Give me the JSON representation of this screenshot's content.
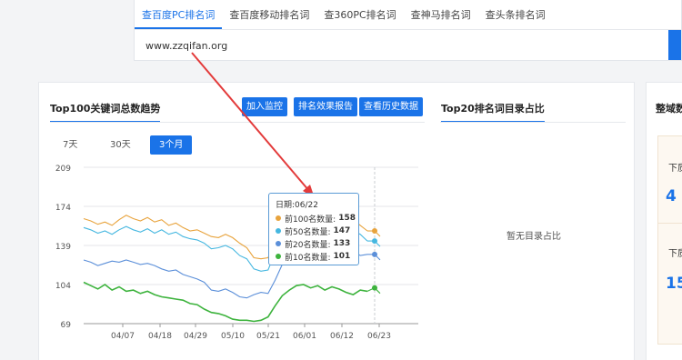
{
  "tabs": [
    {
      "label": "查百度PC排名词",
      "active": true
    },
    {
      "label": "查百度移动排名词",
      "active": false
    },
    {
      "label": "查360PC排名词",
      "active": false
    },
    {
      "label": "查神马排名词",
      "active": false
    },
    {
      "label": "查头条排名词",
      "active": false
    }
  ],
  "search": {
    "value": "www.zzqifan.org"
  },
  "panel": {
    "title": "Top100关键词总数趋势",
    "buttons": {
      "monitor": "加入监控",
      "report": "排名效果报告",
      "history": "查看历史数据"
    },
    "ranges": [
      {
        "label": "7天",
        "active": false
      },
      {
        "label": "30天",
        "active": false
      },
      {
        "label": "3个月",
        "active": true
      }
    ]
  },
  "right_panel": {
    "title": "Top20排名词目录占比",
    "empty_text": "暂无目录占比"
  },
  "side_card": {
    "title": "整域数",
    "label_1": "下质",
    "value_1": "4",
    "label_2": "下质",
    "value_2": "15"
  },
  "tooltip": {
    "date_label": "日期:06/22",
    "rows": [
      {
        "label": "前100名数量:",
        "value": "158",
        "color": "#e8a33c"
      },
      {
        "label": "前50名数量:",
        "value": "147",
        "color": "#45b7e0"
      },
      {
        "label": "前20名数量:",
        "value": "133",
        "color": "#5b8fd9"
      },
      {
        "label": "前10名数量:",
        "value": "101",
        "color": "#3db33d"
      }
    ]
  },
  "chart_data": {
    "type": "line",
    "y_ticks": [
      69,
      104,
      139,
      174,
      209
    ],
    "x_tick_labels": [
      "04/07",
      "04/18",
      "04/29",
      "05/10",
      "05/21",
      "06/01",
      "06/12",
      "06/23"
    ],
    "ylim": [
      69,
      209
    ],
    "grid": true,
    "series": [
      {
        "name": "前100名数量",
        "color": "#e8a33c",
        "end_value": 152,
        "values": [
          163,
          161,
          158,
          160,
          157,
          162,
          166,
          163,
          161,
          164,
          160,
          162,
          157,
          159,
          155,
          152,
          153,
          150,
          147,
          146,
          149,
          146,
          141,
          137,
          128,
          127,
          128,
          142,
          152,
          163,
          166,
          164,
          162,
          165,
          163,
          168,
          167,
          165,
          162,
          157,
          152
        ]
      },
      {
        "name": "前50名数量",
        "color": "#45b7e0",
        "end_value": 143,
        "values": [
          155,
          153,
          150,
          152,
          149,
          153,
          156,
          153,
          151,
          154,
          150,
          153,
          149,
          151,
          147,
          145,
          144,
          141,
          136,
          137,
          139,
          136,
          130,
          127,
          118,
          116,
          117,
          133,
          144,
          154,
          156,
          155,
          153,
          156,
          154,
          158,
          157,
          155,
          152,
          149,
          143
        ]
      },
      {
        "name": "前20名数量",
        "color": "#5b8fd9",
        "end_value": 131,
        "values": [
          126,
          124,
          121,
          123,
          125,
          124,
          126,
          124,
          122,
          123,
          121,
          118,
          116,
          117,
          113,
          111,
          109,
          106,
          99,
          98,
          100,
          97,
          93,
          92,
          95,
          97,
          96,
          108,
          122,
          138,
          144,
          143,
          140,
          144,
          141,
          146,
          143,
          139,
          134,
          130,
          131
        ]
      },
      {
        "name": "前10名数量",
        "color": "#3db33d",
        "end_value": 101,
        "values": [
          106,
          103,
          100,
          104,
          99,
          102,
          98,
          99,
          96,
          98,
          95,
          93,
          92,
          91,
          90,
          87,
          86,
          82,
          79,
          78,
          76,
          73,
          72,
          72,
          71,
          72,
          75,
          85,
          94,
          99,
          103,
          104,
          101,
          103,
          99,
          102,
          100,
          97,
          95,
          99,
          98
        ]
      }
    ]
  }
}
